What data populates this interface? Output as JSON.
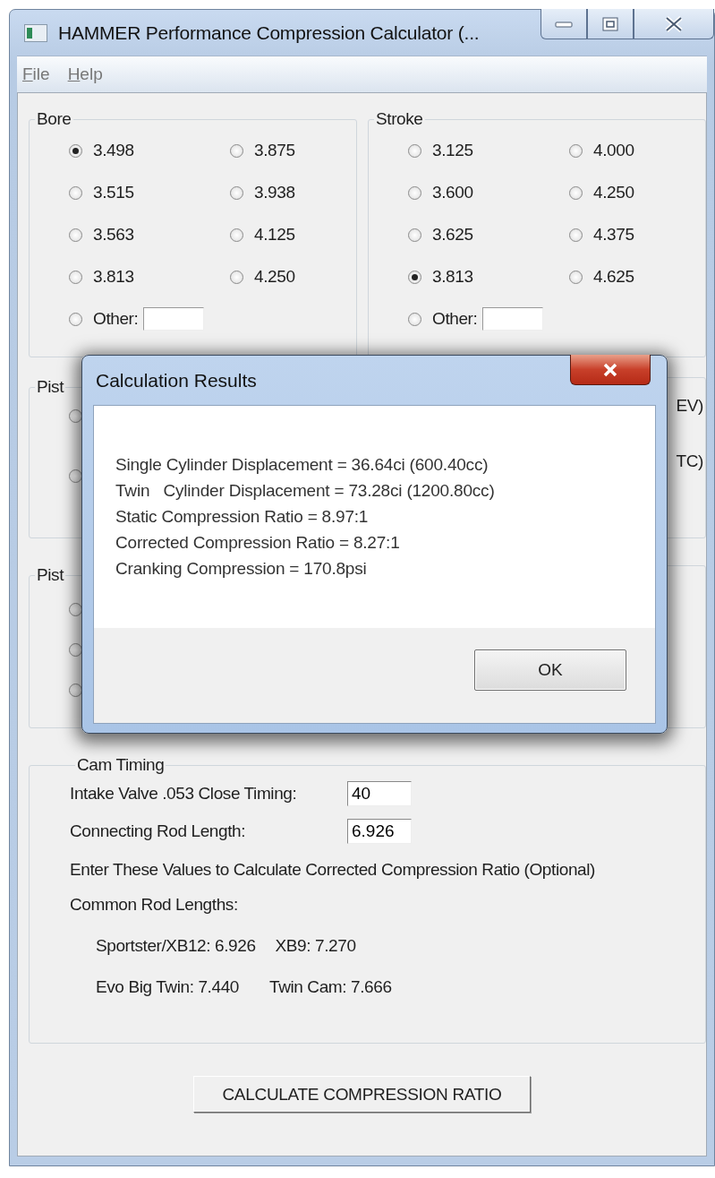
{
  "window": {
    "title": "HAMMER Performance Compression Calculator (..."
  },
  "menu": [
    {
      "label": "File"
    },
    {
      "label": "Help"
    }
  ],
  "bore": {
    "label": "Bore",
    "options": [
      {
        "label": "3.498",
        "selected": true
      },
      {
        "label": "3.875",
        "selected": false
      },
      {
        "label": "3.515",
        "selected": false
      },
      {
        "label": "3.938",
        "selected": false
      },
      {
        "label": "3.563",
        "selected": false
      },
      {
        "label": "4.125",
        "selected": false
      },
      {
        "label": "3.813",
        "selected": false
      },
      {
        "label": "4.250",
        "selected": false
      }
    ],
    "other": {
      "label": "Other:",
      "selected": false
    }
  },
  "stroke": {
    "label": "Stroke",
    "options": [
      {
        "label": "3.125",
        "selected": false
      },
      {
        "label": "4.000",
        "selected": false
      },
      {
        "label": "3.600",
        "selected": false
      },
      {
        "label": "4.250",
        "selected": false
      },
      {
        "label": "3.625",
        "selected": false
      },
      {
        "label": "4.375",
        "selected": false
      },
      {
        "label": "3.813",
        "selected": true
      },
      {
        "label": "4.625",
        "selected": false
      }
    ],
    "other": {
      "label": "Other:",
      "selected": false
    }
  },
  "hidden_groups": [
    {
      "label": "Pist",
      "radios": [
        {
          "selected": false
        },
        {
          "selected": false
        }
      ],
      "right_texts": [
        "EV)",
        "TC)"
      ]
    },
    {
      "label": "Pist",
      "radios": [
        {
          "selected": false
        },
        {
          "selected": false
        },
        {
          "selected": false
        }
      ]
    }
  ],
  "cam_timing": {
    "label": "Cam Timing",
    "fields": [
      {
        "label": "Intake Valve .053 Close Timing:",
        "value": "40"
      },
      {
        "label": "Connecting Rod Length:",
        "value": "6.926"
      }
    ],
    "note": "Enter These Values to Calculate Corrected Compression Ratio (Optional)",
    "common_label": "Common Rod Lengths:",
    "rod_rows": [
      {
        "items": [
          "Sportster/XB12: 6.926",
          "XB9: 7.270"
        ]
      },
      {
        "items": [
          "Evo Big Twin: 7.440",
          "Twin Cam: 7.666"
        ]
      }
    ]
  },
  "calculate_button": "CALCULATE COMPRESSION RATIO",
  "dialog": {
    "title": "Calculation Results",
    "lines": [
      "Single Cylinder Displacement = 36.64ci (600.40cc)",
      "Twin   Cylinder Displacement = 73.28ci (1200.80cc)",
      "Static Compression Ratio = 8.97:1",
      "Corrected Compression Ratio = 8.27:1",
      "Cranking Compression = 170.8psi"
    ],
    "button": "OK"
  }
}
